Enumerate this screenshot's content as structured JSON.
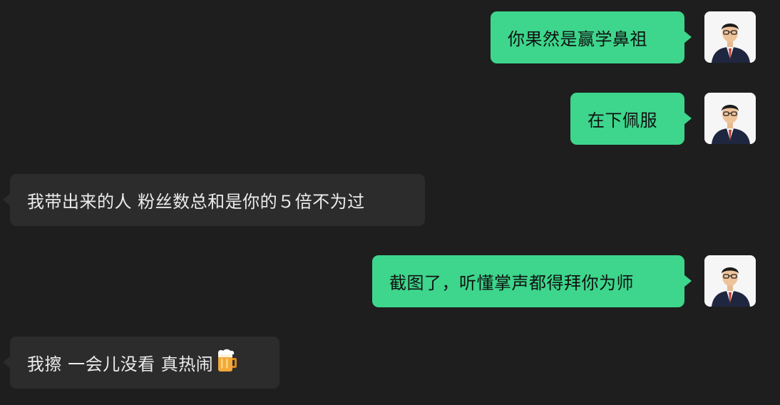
{
  "colors": {
    "background": "#1e1e1e",
    "sent_bubble": "#3dd68c",
    "received_bubble": "#2c2c2c"
  },
  "messages": [
    {
      "direction": "sent",
      "text": "你果然是赢学鼻祖",
      "avatar_icon": "user-avatar-icon"
    },
    {
      "direction": "sent",
      "text": "在下佩服",
      "avatar_icon": "user-avatar-icon"
    },
    {
      "direction": "received",
      "text": "我带出来的人 粉丝数总和是你的５倍不为过"
    },
    {
      "direction": "sent",
      "text": "截图了，听懂掌声都得拜你为师",
      "avatar_icon": "user-avatar-icon"
    },
    {
      "direction": "received",
      "text": "我擦 一会儿没看 真热闹",
      "emoji_icon": "beer-mug-icon"
    }
  ]
}
